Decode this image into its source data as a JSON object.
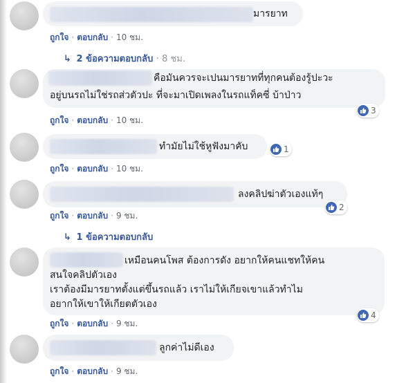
{
  "labels": {
    "like": "ถูกใจ",
    "reply": "ตอบกลับ",
    "dot": "·"
  },
  "comments": [
    {
      "text": "มารยาท",
      "time": "10 ชม."
    },
    {
      "line1": "คือมันควรจะเปนมารยาทที่ทุกคนต้องรู้ปะวะ",
      "line2": "อยู่บนรถไม่ใช่รถส่วตัวปะ ที่จะมาเปิดเพลงในรถแท็คซี่ บ้าป่าว",
      "time": "10 ชม.",
      "likes": "3"
    },
    {
      "text": "ทำมัยไม่ใช้หูฟังมาคับ",
      "time": "10 ชม.",
      "likes": "1"
    },
    {
      "text": "ลงคลิปฆ่าตัวเองแท้ๆ",
      "time": "9 ชม.",
      "likes": "2"
    },
    {
      "line1": "เหมือนคนโพส ต้องการดัง อยากให้คนแชทให้คน",
      "line2": "สนใจคลิปตัวเอง",
      "line3": "เราต้องมีมารยาทตั้งแต่ขึ้นรถแล้ว เราไม่ให้เกียจเขาแล้วทำไม",
      "line4": "อยากให้เขาให้เกียตตัวเอง",
      "time": "9 ชม.",
      "likes": "4"
    },
    {
      "text": "ลูกค่าไม่ดีเอง",
      "time": "9 ชม."
    }
  ],
  "reply_threads": [
    {
      "label": "2 ข้อความตอบกลับ",
      "time": "8 ชม."
    },
    {
      "label": "1 ข้อความตอบกลับ"
    }
  ],
  "colors": {
    "link": "#385898",
    "bubble": "#f2f3f5",
    "like_badge": "#4267b2"
  }
}
